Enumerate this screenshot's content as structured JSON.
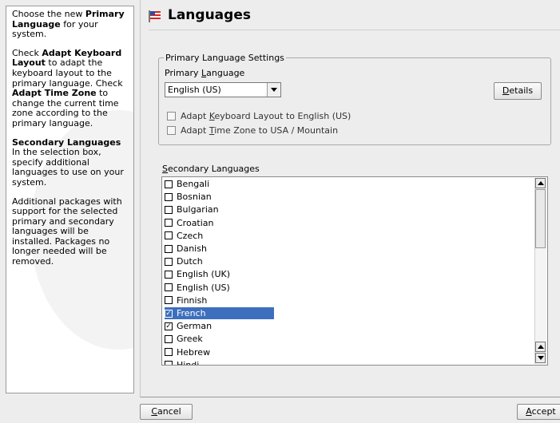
{
  "help": {
    "p1_a": "Choose the new ",
    "p1_b": "Primary Language",
    "p1_c": " for your system.",
    "p2_a": "Check ",
    "p2_b": "Adapt Keyboard Layout",
    "p2_c": " to adapt the keyboard layout to the primary language. Check ",
    "p2_d": "Adapt Time Zone",
    "p2_e": " to change the current time zone according to the primary language.",
    "p3_title": "Secondary Languages",
    "p3_body": "In the selection box, specify additional languages to use on your system.",
    "p4": "Additional packages with support for the selected primary and secondary languages will be installed. Packages no longer needed will be removed."
  },
  "title": "Languages",
  "primary": {
    "group_label": "Primary Language Settings",
    "label_pre": "Primary ",
    "label_u": "L",
    "label_post": "anguage",
    "selected": "English (US)",
    "details_u": "D",
    "details_post": "etails",
    "adapt_keyboard": {
      "pre": "Adapt ",
      "u": "K",
      "post": "eyboard Layout to English (US)",
      "checked": false
    },
    "adapt_timezone": {
      "pre": "Adapt ",
      "u": "T",
      "post": "ime Zone to USA / Mountain",
      "checked": false
    }
  },
  "secondary": {
    "label_u": "S",
    "label_post": "econdary Languages",
    "items": [
      {
        "name": "Bengali",
        "checked": false,
        "selected": false
      },
      {
        "name": "Bosnian",
        "checked": false,
        "selected": false
      },
      {
        "name": "Bulgarian",
        "checked": false,
        "selected": false
      },
      {
        "name": "Croatian",
        "checked": false,
        "selected": false
      },
      {
        "name": "Czech",
        "checked": false,
        "selected": false
      },
      {
        "name": "Danish",
        "checked": false,
        "selected": false
      },
      {
        "name": "Dutch",
        "checked": false,
        "selected": false
      },
      {
        "name": "English (UK)",
        "checked": false,
        "selected": false
      },
      {
        "name": "English (US)",
        "checked": false,
        "selected": false
      },
      {
        "name": "Finnish",
        "checked": false,
        "selected": false
      },
      {
        "name": "French",
        "checked": true,
        "selected": true
      },
      {
        "name": "German",
        "checked": true,
        "selected": false
      },
      {
        "name": "Greek",
        "checked": false,
        "selected": false
      },
      {
        "name": "Hebrew",
        "checked": false,
        "selected": false
      },
      {
        "name": "Hindi",
        "checked": false,
        "selected": false
      }
    ]
  },
  "buttons": {
    "cancel_u": "C",
    "cancel_post": "ancel",
    "accept_u": "A",
    "accept_post": "ccept"
  }
}
